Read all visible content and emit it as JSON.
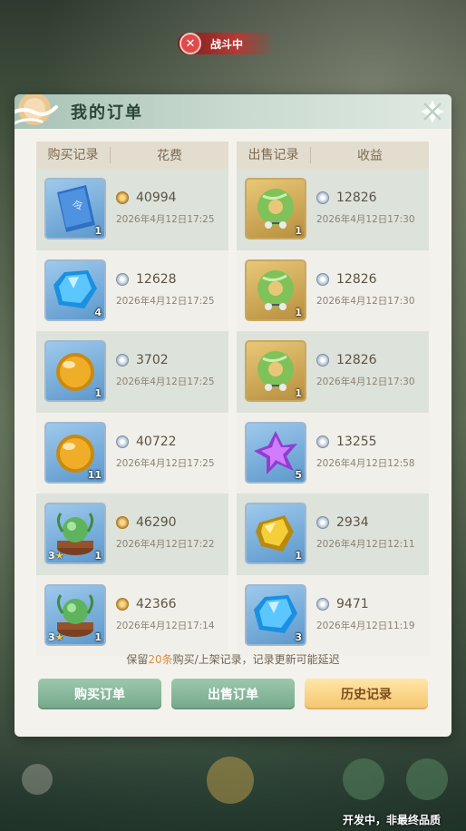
{
  "battle": {
    "label": "战斗中"
  },
  "panel": {
    "title": "我的订单"
  },
  "buy": {
    "header": {
      "record": "购买记录",
      "cost": "花费"
    },
    "rows": [
      {
        "item": "blue-scroll-icon",
        "qty": "1",
        "stars": "",
        "currency": "coin",
        "price": "40994",
        "time": "2026年4月12日17:25"
      },
      {
        "item": "blue-gem-icon",
        "qty": "4",
        "stars": "",
        "currency": "silver",
        "price": "12628",
        "time": "2026年4月12日17:25"
      },
      {
        "item": "amber-orb-icon",
        "qty": "1",
        "stars": "",
        "currency": "silver",
        "price": "3702",
        "time": "2026年4月12日17:25"
      },
      {
        "item": "amber-orb-icon",
        "qty": "11",
        "stars": "",
        "currency": "silver",
        "price": "40722",
        "time": "2026年4月12日17:25"
      },
      {
        "item": "plant-pot-icon",
        "qty": "1",
        "stars": "3",
        "currency": "coin",
        "price": "46290",
        "time": "2026年4月12日17:22"
      },
      {
        "item": "plant-pot-icon",
        "qty": "1",
        "stars": "3",
        "currency": "coin",
        "price": "42366",
        "time": "2026年4月12日17:14"
      }
    ]
  },
  "sell": {
    "header": {
      "record": "出售记录",
      "income": "收益"
    },
    "rows": [
      {
        "item": "jade-ring-icon",
        "qty": "1",
        "currency": "silver",
        "price": "12826",
        "time": "2026年4月12日17:30"
      },
      {
        "item": "jade-ring-icon",
        "qty": "1",
        "currency": "silver",
        "price": "12826",
        "time": "2026年4月12日17:30"
      },
      {
        "item": "jade-ring-icon",
        "qty": "1",
        "currency": "silver",
        "price": "12826",
        "time": "2026年4月12日17:30"
      },
      {
        "item": "purple-crystal-icon",
        "qty": "5",
        "currency": "silver",
        "price": "13255",
        "time": "2026年4月12日12:58"
      },
      {
        "item": "gold-nugget-icon",
        "qty": "1",
        "currency": "silver",
        "price": "2934",
        "time": "2026年4月12日12:11"
      },
      {
        "item": "blue-gem-icon",
        "qty": "3",
        "currency": "silver",
        "price": "9471",
        "time": "2026年4月12日11:19"
      }
    ]
  },
  "notice": {
    "before": "保留",
    "count": "20条",
    "after": "购买/上架记录，记录更新可能延迟"
  },
  "buttons": {
    "buy_orders": "购买订单",
    "sell_orders": "出售订单",
    "history": "历史记录"
  },
  "footer": {
    "text": "开发中，非最终品质"
  }
}
